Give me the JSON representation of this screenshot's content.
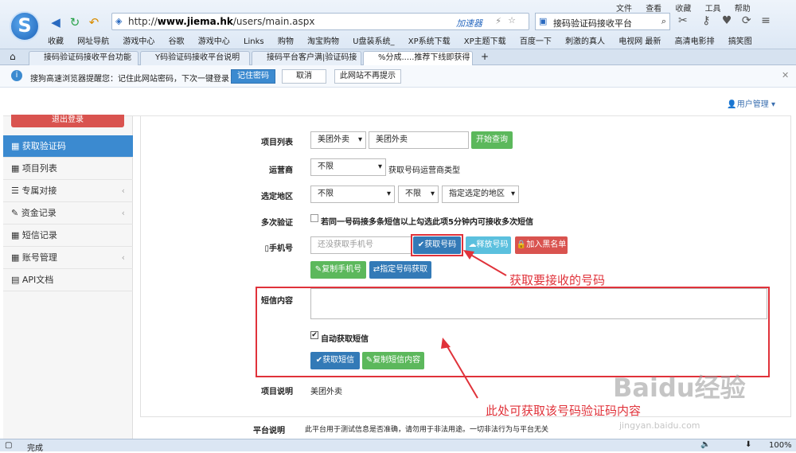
{
  "browser": {
    "url_prefix": "http://",
    "url_domain": "www.jiema.hk",
    "url_path": "/users/main.aspx",
    "accelerator": "加速器",
    "search_text": "接码验证码接收平台",
    "menu": [
      "文件",
      "查看",
      "收藏",
      "工具",
      "帮助"
    ],
    "bookmarks": [
      "收藏",
      "网址导航",
      "游戏中心",
      "谷歌",
      "游戏中心",
      "Links",
      "购物",
      "淘宝购物",
      "U盘装系统_",
      "XP系统下载",
      "XP主题下载",
      "百度一下",
      "刺激的真人",
      "电视网 最新",
      "高清电影排",
      "搞笑图"
    ],
    "tabs": [
      "接码验证码接收平台功能",
      "Y码验证码接收平台说明",
      "接码平台客户满|验证码接",
      "%分成.....推荐下线即获得"
    ],
    "notice_text": "搜狗高速浏览器提醒您：记住此网站密码，下次一键登录！",
    "notice_buttons": [
      "记住密码",
      "取消",
      "此网站不再提示"
    ],
    "status": "完成",
    "zoom": "100%"
  },
  "header": {
    "user_menu": "用户管理"
  },
  "sidebar": {
    "logout": "退出登录",
    "items": [
      {
        "label": "获取验证码",
        "icon": "grid-icon"
      },
      {
        "label": "项目列表",
        "icon": "grid-icon"
      },
      {
        "label": "专属对接",
        "icon": "list-icon"
      },
      {
        "label": "资金记录",
        "icon": "pencil-icon"
      },
      {
        "label": "短信记录",
        "icon": "grid-icon"
      },
      {
        "label": "账号管理",
        "icon": "grid-icon"
      },
      {
        "label": "API文档",
        "icon": "film-icon"
      }
    ]
  },
  "form": {
    "project_label": "项目列表",
    "project_select": "美团外卖",
    "project_input": "美团外卖",
    "query_button": "开始查询",
    "carrier_label": "运营商",
    "carrier_select": "不限",
    "carrier_hint": "获取号码运营商类型",
    "region_label": "选定地区",
    "region_select1": "不限",
    "region_select2": "不限",
    "region_select3": "指定选定的地区",
    "multi_label": "多次验证",
    "multi_text": "若同一号码接多条短信以上勾选此项5分钟内可接收多次短信",
    "phone_label": "手机号",
    "phone_placeholder": "还没获取手机号",
    "get_number_button": "获取号码",
    "release_button": "释放号码",
    "blacklist_button": "加入黑名单",
    "copy_phone_button": "复制手机号",
    "specify_button": "指定号码获取",
    "sms_label": "短信内容",
    "auto_sms_label": "自动获取短信",
    "get_sms_button": "获取短信",
    "copy_sms_button": "复制短信内容",
    "desc_label": "项目说明",
    "desc_value": "美团外卖"
  },
  "platform": {
    "label": "平台说明",
    "text": "此平台用于测试信息是否准确，请勿用于非法用途。一切非法行为与平台无关"
  },
  "annotations": {
    "arrow1": "获取要接收的号码",
    "arrow2": "此处可获取该号码验证码内容"
  },
  "watermark": {
    "brand": "Baidu经验",
    "site": "jingyan.baidu.com"
  }
}
